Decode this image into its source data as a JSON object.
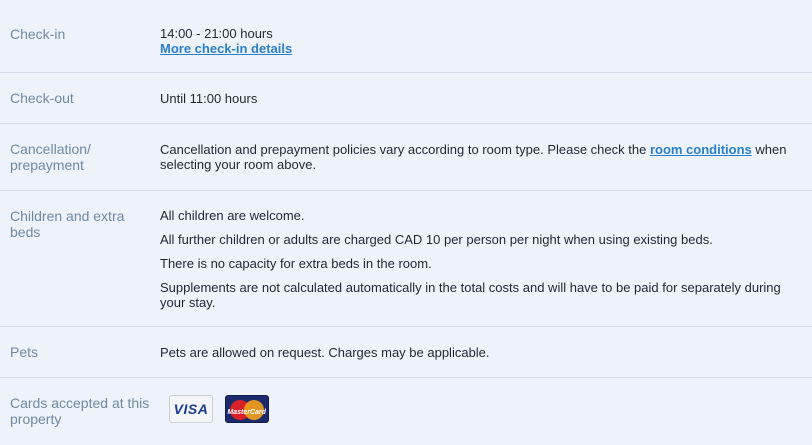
{
  "rows": {
    "checkin": {
      "label": "Check-in",
      "hours": "14:00 - 21:00 hours",
      "details_link": "More check-in details"
    },
    "checkout": {
      "label": "Check-out",
      "hours": "Until 11:00 hours"
    },
    "cancellation": {
      "label_line1": "Cancellation/",
      "label_line2": "prepayment",
      "text_before": "Cancellation and prepayment policies vary according to room type. Please check the ",
      "link": "room conditions",
      "text_after": " when selecting your room above."
    },
    "children": {
      "label_line1": "Children and extra",
      "label_line2": "beds",
      "lines": [
        "All children are welcome.",
        "All further children or adults are charged CAD 10 per person per night when using existing beds.",
        "There is no capacity for extra beds in the room.",
        "Supplements are not calculated automatically in the total costs and will have to be paid for separately during your stay."
      ]
    },
    "pets": {
      "label": "Pets",
      "text": "Pets are allowed on request. Charges may be applicable."
    },
    "cards": {
      "label_line1": "Cards accepted at this",
      "label_line2": "property",
      "visa_text": "VISA",
      "mastercard_text": "MasterCard",
      "icons": [
        "visa-card-icon",
        "mastercard-icon"
      ]
    }
  },
  "colors": {
    "background": "#eef3fa",
    "label": "#6f89a3",
    "link": "#2a7fc9",
    "divider": "#d6deea"
  }
}
